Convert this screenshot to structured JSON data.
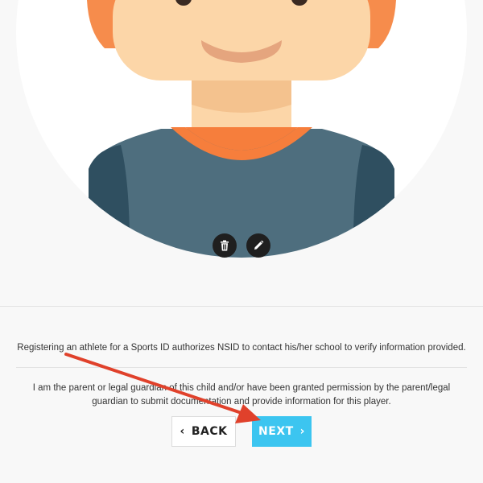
{
  "avatar": {
    "colors": {
      "skin": "#fcd6a8",
      "hair": "#f68c4c",
      "shirt": "#4e6e7e",
      "collar": "#f67e3c",
      "background": "#ffffff"
    },
    "actions": [
      {
        "name": "delete",
        "icon": "trash-icon"
      },
      {
        "name": "edit",
        "icon": "pencil-icon"
      }
    ]
  },
  "notice_text": "Registering an athlete for a Sports ID authorizes NSID to contact his/her school to verify information provided.",
  "consent_text": "I am the parent or legal guardian of this child and/or have been granted permission by the parent/legal guardian to submit documentation and provide information for this player.",
  "buttons": {
    "back": {
      "label": "BACK",
      "icon": "chevron-left-icon"
    },
    "next": {
      "label": "NEXT",
      "icon": "chevron-right-icon",
      "color": "#3cc5f0"
    }
  },
  "annotation": {
    "color": "#e0412b",
    "icon": "red-arrow"
  }
}
